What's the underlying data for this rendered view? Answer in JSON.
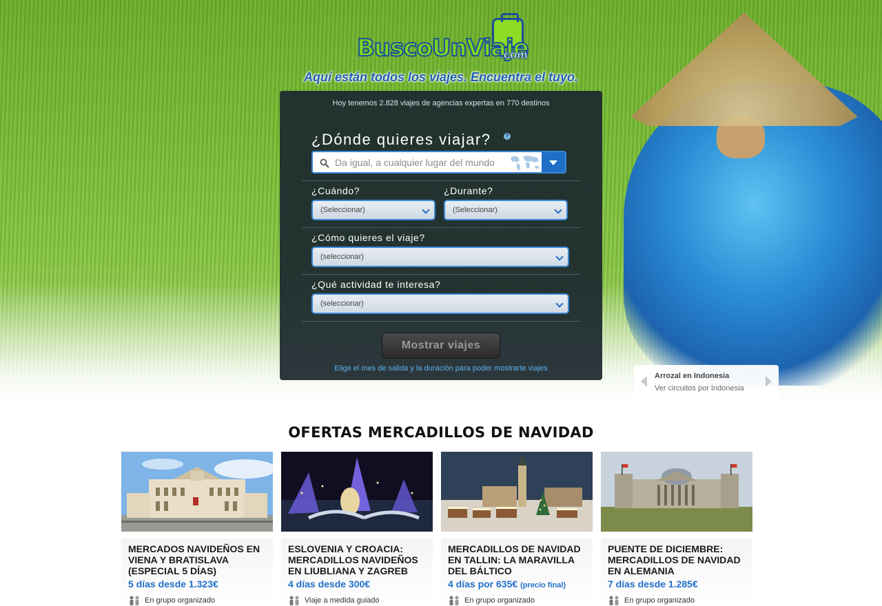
{
  "brand": {
    "logo_text": "BuscoUnViaje",
    "logo_suffix": ".com",
    "tagline": "Aquí están todos los viajes. Encuentra el tuyo."
  },
  "search": {
    "info": "Hoy tenemos 2.828 viajes de agencias expertas en 770 destinos",
    "destination_question": "¿Dónde quieres viajar?",
    "destination_placeholder": "Da igual, a cualquier lugar del mundo",
    "when_label": "¿Cuándo?",
    "when_value": "(Seleccionar)",
    "duration_label": "¿Durante?",
    "duration_value": "(Seleccionar)",
    "how_label": "¿Cómo quieres el viaje?",
    "how_value": "(seleccionar)",
    "activity_label": "¿Qué actividad te interesa?",
    "activity_value": "(seleccionar)",
    "submit_label": "Mostrar viajes",
    "note": "Elige el mes de salida y la duración para poder mostrarte viajes"
  },
  "photo_caption": {
    "title": "Arrozal en Indonesia",
    "link": "Ver circuitos por Indonesia"
  },
  "offers": {
    "heading": "OFERTAS MERCADILLOS DE NAVIDAD",
    "cards": [
      {
        "name": "MERCADOS NAVIDEÑOS EN VIENA Y BRATISLAVA (ESPECIAL 5 DÍAS)",
        "price": "5 días desde 1.323€",
        "price_note": "",
        "type": "En grupo organizado"
      },
      {
        "name": "ESLOVENIA Y CROACIA: MERCADILLOS NAVIDEÑOS EN LIUBLIANA Y ZAGREB",
        "price": "4 días desde 300€",
        "price_note": "",
        "type": "Viaje a medida guiado"
      },
      {
        "name": "MERCADILLOS DE NAVIDAD EN TALLIN: LA MARAVILLA DEL BÁLTICO",
        "price": "4 días por 635€",
        "price_note": "(precio final)",
        "type": "En grupo organizado"
      },
      {
        "name": "PUENTE DE DICIEMBRE: MERCADILLOS DE NAVIDAD EN ALEMANIA",
        "price": "7 días desde 1.285€",
        "price_note": "",
        "type": "En grupo organizado"
      }
    ]
  },
  "colors": {
    "accent_blue": "#1f6fc7",
    "logo_green": "#7ed321",
    "panel_dark": "#1c282e"
  }
}
